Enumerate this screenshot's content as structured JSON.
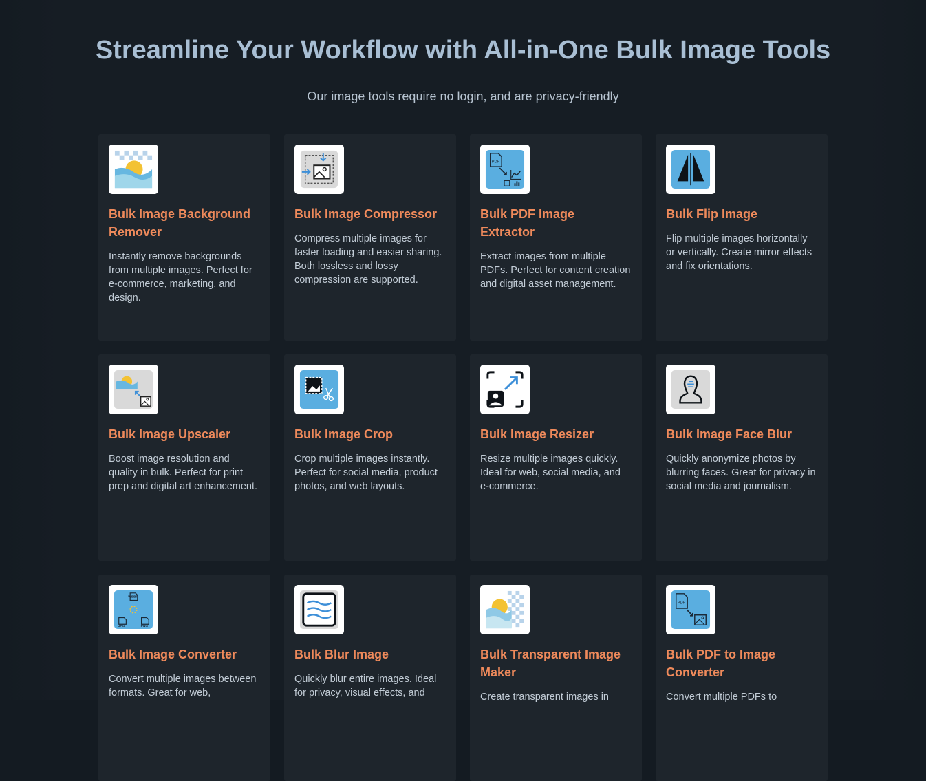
{
  "hero": {
    "title": "Streamline Your Workflow with All-in-One Bulk Image Tools",
    "subtitle": "Our image tools require no login, and are privacy-friendly"
  },
  "colors": {
    "background": "#161d24",
    "card": "#1e252c",
    "title": "#a9bfd4",
    "accent": "#ef8a5b",
    "icon_blue": "#5aaee0"
  },
  "tools": [
    {
      "icon": "background-remover-icon",
      "title": "Bulk Image Background Remover",
      "description": "Instantly remove backgrounds from multiple images. Perfect for e-commerce, marketing, and design."
    },
    {
      "icon": "compressor-icon",
      "title": "Bulk Image Compressor",
      "description": "Compress multiple images for faster loading and easier sharing. Both lossless and lossy compression are supported."
    },
    {
      "icon": "pdf-extractor-icon",
      "title": "Bulk PDF Image Extractor",
      "description": "Extract images from multiple PDFs. Perfect for content creation and digital asset management."
    },
    {
      "icon": "flip-icon",
      "title": "Bulk Flip Image",
      "description": "Flip multiple images horizontally or vertically. Create mirror effects and fix orientations."
    },
    {
      "icon": "upscaler-icon",
      "title": "Bulk Image Upscaler",
      "description": "Boost image resolution and quality in bulk. Perfect for print prep and digital art enhancement."
    },
    {
      "icon": "crop-icon",
      "title": "Bulk Image Crop",
      "description": "Crop multiple images instantly. Perfect for social media, product photos, and web layouts."
    },
    {
      "icon": "resizer-icon",
      "title": "Bulk Image Resizer",
      "description": "Resize multiple images quickly. Ideal for web, social media, and e-commerce."
    },
    {
      "icon": "face-blur-icon",
      "title": "Bulk Image Face Blur",
      "description": "Quickly anonymize photos by blurring faces. Great for privacy in social media and journalism."
    },
    {
      "icon": "converter-icon",
      "title": "Bulk Image Converter",
      "description": "Convert multiple images between formats. Great for web,"
    },
    {
      "icon": "blur-icon",
      "title": "Bulk Blur Image",
      "description": "Quickly blur entire images. Ideal for privacy, visual effects, and"
    },
    {
      "icon": "transparent-maker-icon",
      "title": "Bulk Transparent Image Maker",
      "description": "Create transparent images in"
    },
    {
      "icon": "pdf-to-image-icon",
      "title": "Bulk PDF to Image Converter",
      "description": "Convert multiple PDFs to"
    }
  ]
}
